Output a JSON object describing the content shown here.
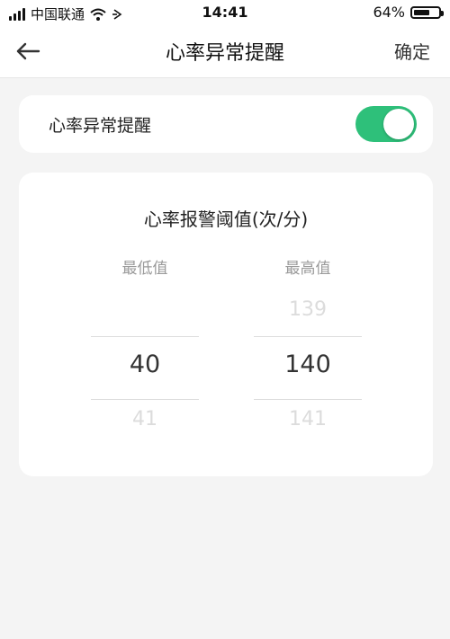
{
  "status_bar": {
    "carrier": "中国联通",
    "time": "14:41",
    "battery_percent": "64%",
    "battery_level": 0.64,
    "icons": [
      "signal-icon",
      "wifi-icon",
      "location-arrow-icon",
      "battery-icon"
    ]
  },
  "nav": {
    "back_icon": "back-arrow-icon",
    "title": "心率异常提醒",
    "confirm_label": "确定"
  },
  "alert_toggle": {
    "label": "心率异常提醒",
    "enabled": true,
    "on_color": "#2ec07a"
  },
  "threshold": {
    "title": "心率报警阈值(次/分)",
    "min": {
      "header": "最低值",
      "prev": "",
      "current": "40",
      "next": "41"
    },
    "max": {
      "header": "最高值",
      "prev": "139",
      "current": "140",
      "next": "141"
    }
  }
}
